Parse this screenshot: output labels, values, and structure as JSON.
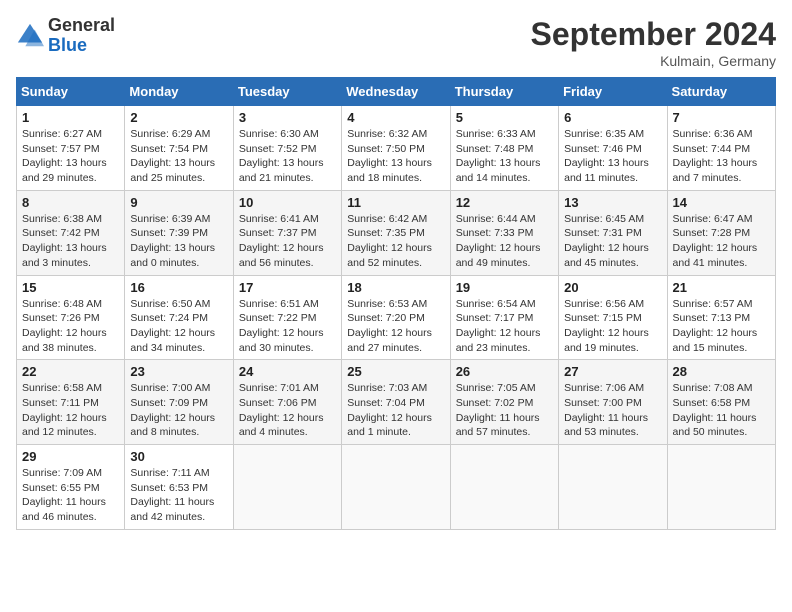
{
  "header": {
    "logo": {
      "line1": "General",
      "line2": "Blue"
    },
    "title": "September 2024",
    "subtitle": "Kulmain, Germany"
  },
  "weekdays": [
    "Sunday",
    "Monday",
    "Tuesday",
    "Wednesday",
    "Thursday",
    "Friday",
    "Saturday"
  ],
  "weeks": [
    [
      {
        "day": "1",
        "sunrise": "Sunrise: 6:27 AM",
        "sunset": "Sunset: 7:57 PM",
        "daylight": "Daylight: 13 hours and 29 minutes."
      },
      {
        "day": "2",
        "sunrise": "Sunrise: 6:29 AM",
        "sunset": "Sunset: 7:54 PM",
        "daylight": "Daylight: 13 hours and 25 minutes."
      },
      {
        "day": "3",
        "sunrise": "Sunrise: 6:30 AM",
        "sunset": "Sunset: 7:52 PM",
        "daylight": "Daylight: 13 hours and 21 minutes."
      },
      {
        "day": "4",
        "sunrise": "Sunrise: 6:32 AM",
        "sunset": "Sunset: 7:50 PM",
        "daylight": "Daylight: 13 hours and 18 minutes."
      },
      {
        "day": "5",
        "sunrise": "Sunrise: 6:33 AM",
        "sunset": "Sunset: 7:48 PM",
        "daylight": "Daylight: 13 hours and 14 minutes."
      },
      {
        "day": "6",
        "sunrise": "Sunrise: 6:35 AM",
        "sunset": "Sunset: 7:46 PM",
        "daylight": "Daylight: 13 hours and 11 minutes."
      },
      {
        "day": "7",
        "sunrise": "Sunrise: 6:36 AM",
        "sunset": "Sunset: 7:44 PM",
        "daylight": "Daylight: 13 hours and 7 minutes."
      }
    ],
    [
      {
        "day": "8",
        "sunrise": "Sunrise: 6:38 AM",
        "sunset": "Sunset: 7:42 PM",
        "daylight": "Daylight: 13 hours and 3 minutes."
      },
      {
        "day": "9",
        "sunrise": "Sunrise: 6:39 AM",
        "sunset": "Sunset: 7:39 PM",
        "daylight": "Daylight: 13 hours and 0 minutes."
      },
      {
        "day": "10",
        "sunrise": "Sunrise: 6:41 AM",
        "sunset": "Sunset: 7:37 PM",
        "daylight": "Daylight: 12 hours and 56 minutes."
      },
      {
        "day": "11",
        "sunrise": "Sunrise: 6:42 AM",
        "sunset": "Sunset: 7:35 PM",
        "daylight": "Daylight: 12 hours and 52 minutes."
      },
      {
        "day": "12",
        "sunrise": "Sunrise: 6:44 AM",
        "sunset": "Sunset: 7:33 PM",
        "daylight": "Daylight: 12 hours and 49 minutes."
      },
      {
        "day": "13",
        "sunrise": "Sunrise: 6:45 AM",
        "sunset": "Sunset: 7:31 PM",
        "daylight": "Daylight: 12 hours and 45 minutes."
      },
      {
        "day": "14",
        "sunrise": "Sunrise: 6:47 AM",
        "sunset": "Sunset: 7:28 PM",
        "daylight": "Daylight: 12 hours and 41 minutes."
      }
    ],
    [
      {
        "day": "15",
        "sunrise": "Sunrise: 6:48 AM",
        "sunset": "Sunset: 7:26 PM",
        "daylight": "Daylight: 12 hours and 38 minutes."
      },
      {
        "day": "16",
        "sunrise": "Sunrise: 6:50 AM",
        "sunset": "Sunset: 7:24 PM",
        "daylight": "Daylight: 12 hours and 34 minutes."
      },
      {
        "day": "17",
        "sunrise": "Sunrise: 6:51 AM",
        "sunset": "Sunset: 7:22 PM",
        "daylight": "Daylight: 12 hours and 30 minutes."
      },
      {
        "day": "18",
        "sunrise": "Sunrise: 6:53 AM",
        "sunset": "Sunset: 7:20 PM",
        "daylight": "Daylight: 12 hours and 27 minutes."
      },
      {
        "day": "19",
        "sunrise": "Sunrise: 6:54 AM",
        "sunset": "Sunset: 7:17 PM",
        "daylight": "Daylight: 12 hours and 23 minutes."
      },
      {
        "day": "20",
        "sunrise": "Sunrise: 6:56 AM",
        "sunset": "Sunset: 7:15 PM",
        "daylight": "Daylight: 12 hours and 19 minutes."
      },
      {
        "day": "21",
        "sunrise": "Sunrise: 6:57 AM",
        "sunset": "Sunset: 7:13 PM",
        "daylight": "Daylight: 12 hours and 15 minutes."
      }
    ],
    [
      {
        "day": "22",
        "sunrise": "Sunrise: 6:58 AM",
        "sunset": "Sunset: 7:11 PM",
        "daylight": "Daylight: 12 hours and 12 minutes."
      },
      {
        "day": "23",
        "sunrise": "Sunrise: 7:00 AM",
        "sunset": "Sunset: 7:09 PM",
        "daylight": "Daylight: 12 hours and 8 minutes."
      },
      {
        "day": "24",
        "sunrise": "Sunrise: 7:01 AM",
        "sunset": "Sunset: 7:06 PM",
        "daylight": "Daylight: 12 hours and 4 minutes."
      },
      {
        "day": "25",
        "sunrise": "Sunrise: 7:03 AM",
        "sunset": "Sunset: 7:04 PM",
        "daylight": "Daylight: 12 hours and 1 minute."
      },
      {
        "day": "26",
        "sunrise": "Sunrise: 7:05 AM",
        "sunset": "Sunset: 7:02 PM",
        "daylight": "Daylight: 11 hours and 57 minutes."
      },
      {
        "day": "27",
        "sunrise": "Sunrise: 7:06 AM",
        "sunset": "Sunset: 7:00 PM",
        "daylight": "Daylight: 11 hours and 53 minutes."
      },
      {
        "day": "28",
        "sunrise": "Sunrise: 7:08 AM",
        "sunset": "Sunset: 6:58 PM",
        "daylight": "Daylight: 11 hours and 50 minutes."
      }
    ],
    [
      {
        "day": "29",
        "sunrise": "Sunrise: 7:09 AM",
        "sunset": "Sunset: 6:55 PM",
        "daylight": "Daylight: 11 hours and 46 minutes."
      },
      {
        "day": "30",
        "sunrise": "Sunrise: 7:11 AM",
        "sunset": "Sunset: 6:53 PM",
        "daylight": "Daylight: 11 hours and 42 minutes."
      },
      null,
      null,
      null,
      null,
      null
    ]
  ]
}
